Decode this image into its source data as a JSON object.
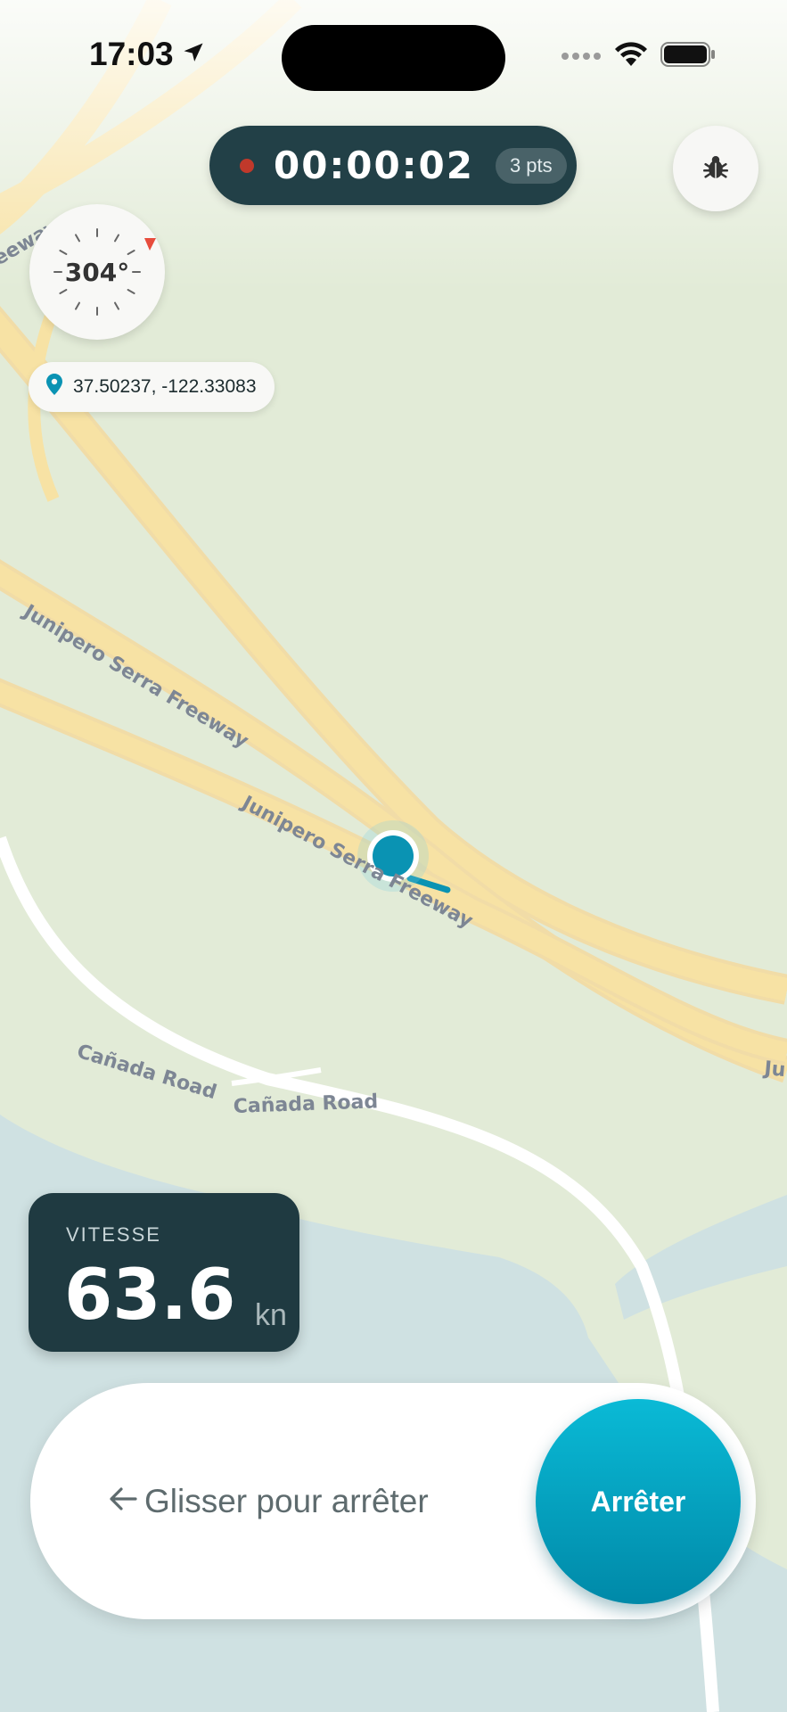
{
  "status_bar": {
    "time": "17:03"
  },
  "timer": {
    "elapsed": "00:00:02",
    "points": "3 pts"
  },
  "compass": {
    "heading": "304°"
  },
  "location": {
    "coords": "37.50237, -122.33083"
  },
  "map_labels": {
    "road_1": "Junipero Serra Freeway",
    "road_2": "Junipero Serra Freeway",
    "road_3": "Cañada Road",
    "road_4": "Cañada Road",
    "road_5": "eeway",
    "road_6": "Ju"
  },
  "speed": {
    "label": "VITESSE",
    "value": "63.6",
    "unit": "kn"
  },
  "stop_slider": {
    "hint": "Glisser pour arrêter",
    "button_label": "Arrêter"
  },
  "icons": {
    "location_arrow": "location-arrow-icon",
    "wifi": "wifi-icon",
    "battery": "battery-icon",
    "bug": "bug-icon",
    "pin": "pin-icon",
    "arrow_left": "arrow-left-icon"
  },
  "colors": {
    "accent": "#0a9bbd",
    "dark_panel": "#1f3a41",
    "record": "#c0392b"
  }
}
